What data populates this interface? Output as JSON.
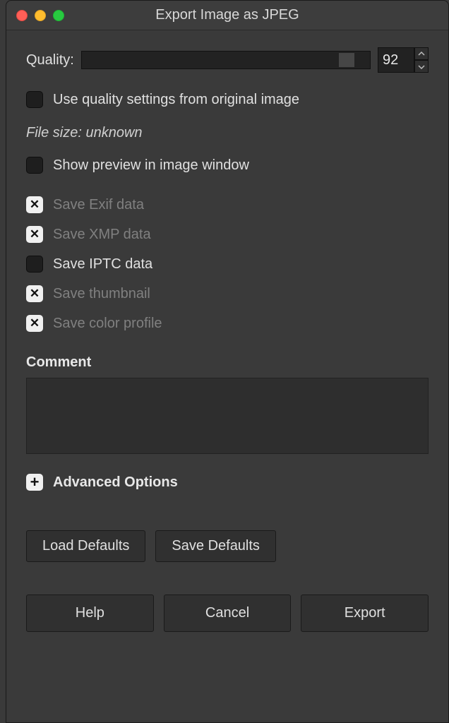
{
  "window": {
    "title": "Export Image as JPEG"
  },
  "quality": {
    "label": "Quality:",
    "value": "92"
  },
  "checkboxes": {
    "use_original": {
      "label": "Use quality settings from original image",
      "checked": false,
      "enabled": true
    },
    "show_preview": {
      "label": "Show preview in image window",
      "checked": false,
      "enabled": true
    },
    "save_exif": {
      "label": "Save Exif data",
      "checked": true,
      "enabled": false
    },
    "save_xmp": {
      "label": "Save XMP data",
      "checked": true,
      "enabled": false
    },
    "save_iptc": {
      "label": "Save IPTC data",
      "checked": false,
      "enabled": true
    },
    "save_thumbnail": {
      "label": "Save thumbnail",
      "checked": true,
      "enabled": false
    },
    "save_color_profile": {
      "label": "Save color profile",
      "checked": true,
      "enabled": false
    }
  },
  "file_size": "File size: unknown",
  "comment": {
    "label": "Comment",
    "value": ""
  },
  "advanced": {
    "label": "Advanced Options"
  },
  "buttons": {
    "load_defaults": "Load Defaults",
    "save_defaults": "Save Defaults",
    "help": "Help",
    "cancel": "Cancel",
    "export": "Export"
  }
}
